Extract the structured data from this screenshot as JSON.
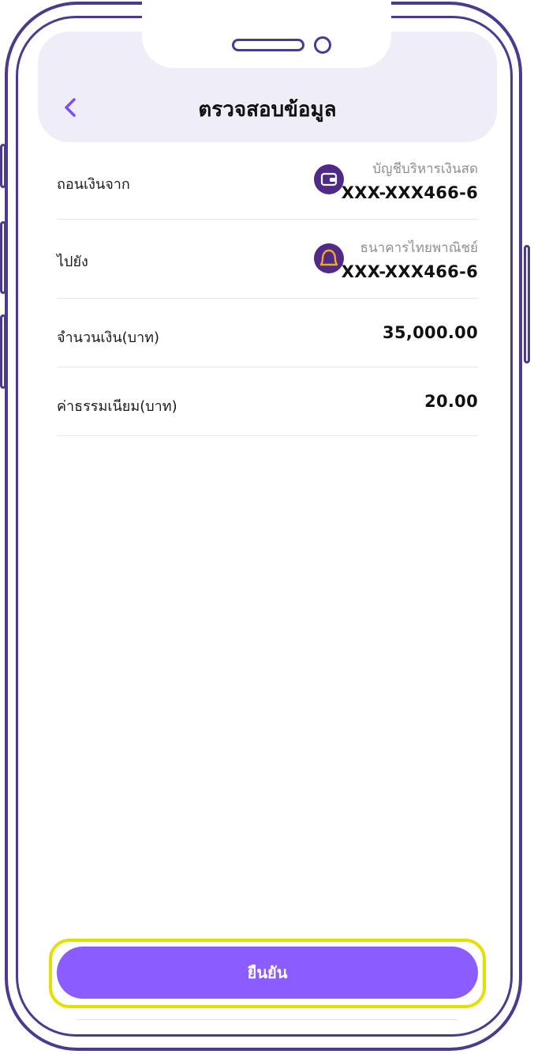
{
  "header": {
    "title": "ตรวจสอบข้อมูล",
    "back_icon": "chevron-left-icon"
  },
  "rows": [
    {
      "label": "ถอนเงินจาก",
      "sub": "บัญชีบริหารเงินสด",
      "value": "XXX-XXX466-6",
      "icon": "wallet-icon"
    },
    {
      "label": "ไปยัง",
      "sub": "ธนาคารไทยพาณิชย์",
      "value": "XXX-XXX466-6",
      "icon": "bank-logo-icon"
    },
    {
      "label": "จำนวนเงิน(บาท)",
      "value": "35,000.00"
    },
    {
      "label": "ค่าธรรมเนียม(บาท)",
      "value": "20.00"
    }
  ],
  "confirm_button": {
    "label": "ยืนยัน"
  },
  "colors": {
    "accent": "#8b5cff",
    "frame": "#4b3a8e",
    "header_bg": "#efedf7",
    "icon_bg": "#4f2a87",
    "bank_logo": "#f0a726",
    "highlight": "#e3e000"
  }
}
